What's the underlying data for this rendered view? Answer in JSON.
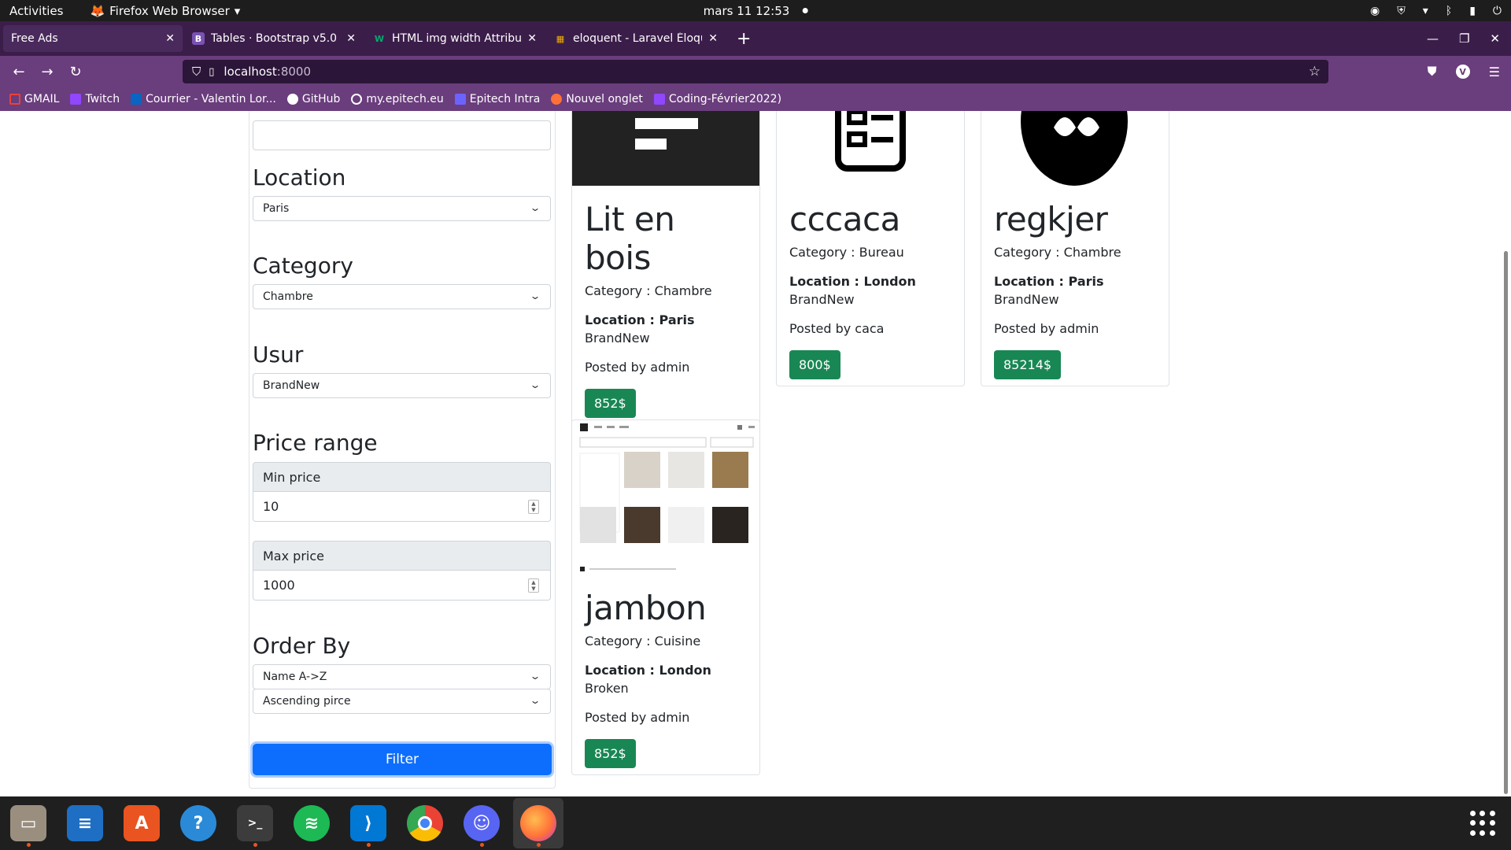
{
  "system": {
    "activities": "Activities",
    "app_name": "Firefox Web Browser",
    "clock": "mars 11  12:53"
  },
  "browser": {
    "tabs": [
      {
        "label": "Free Ads",
        "favicon": "",
        "color": "#4a2a5c"
      },
      {
        "label": "Tables · Bootstrap v5.0",
        "favicon": "B",
        "color": "#7952b3"
      },
      {
        "label": "HTML img width Attribute",
        "favicon": "W",
        "color": "#04aa6d"
      },
      {
        "label": "eloquent - Laravel Éloque",
        "favicon": "▦",
        "color": "#f2b100"
      }
    ],
    "url_host": "localhost",
    "url_port": ":8000",
    "bookmarks": [
      {
        "label": "GMAIL",
        "color": "#ea4335"
      },
      {
        "label": "Twitch",
        "color": "#9146ff"
      },
      {
        "label": "Courrier - Valentin Lor...",
        "color": "#0a64c2"
      },
      {
        "label": "GitHub",
        "color": "#ffffff"
      },
      {
        "label": "my.epitech.eu",
        "color": "#ffffff"
      },
      {
        "label": "Epitech Intra",
        "color": "#6c63ff"
      },
      {
        "label": "Nouvel onglet",
        "color": "#ff7139"
      },
      {
        "label": "Coding-Février2022)",
        "color": "#9146ff"
      }
    ]
  },
  "filters": {
    "location_title": "Location",
    "location_value": "Paris",
    "category_title": "Category",
    "category_value": "Chambre",
    "usur_title": "Usur",
    "usur_value": "BrandNew",
    "price_title": "Price range",
    "min_label": "Min price",
    "min_value": "10",
    "max_label": "Max price",
    "max_value": "1000",
    "order_title": "Order By",
    "order_name": "Name A->Z",
    "order_price": "Ascending pirce",
    "filter_button": "Filter"
  },
  "cards": [
    {
      "title": "Lit en bois",
      "category": "Category : Chambre",
      "location": "Location : Paris",
      "state": "BrandNew",
      "posted": "Posted by admin",
      "price": "852$"
    },
    {
      "title": "cccaca",
      "category": "Category : Bureau",
      "location": "Location : London",
      "state": "BrandNew",
      "posted": "Posted by caca",
      "price": "800$"
    },
    {
      "title": "regkjer",
      "category": "Category : Chambre",
      "location": "Location : Paris",
      "state": "BrandNew",
      "posted": "Posted by admin",
      "price": "85214$"
    },
    {
      "title": "jambon",
      "category": "Category : Cuisine",
      "location": "Location : London",
      "state": "Broken",
      "posted": "Posted by admin",
      "price": "852$"
    }
  ],
  "dock": [
    {
      "name": "files",
      "color": "#9a8f7f"
    },
    {
      "name": "writer",
      "color": "#1e6fc4"
    },
    {
      "name": "software",
      "color": "#e95420"
    },
    {
      "name": "help",
      "color": "#2a8ad8"
    },
    {
      "name": "terminal",
      "color": "#3c3c3c"
    },
    {
      "name": "spotify",
      "color": "#1db954"
    },
    {
      "name": "vscode",
      "color": "#0078d4"
    },
    {
      "name": "chrome",
      "color": "#ffffff"
    },
    {
      "name": "discord",
      "color": "#5865f2"
    },
    {
      "name": "firefox",
      "color": "#ff7139"
    }
  ]
}
